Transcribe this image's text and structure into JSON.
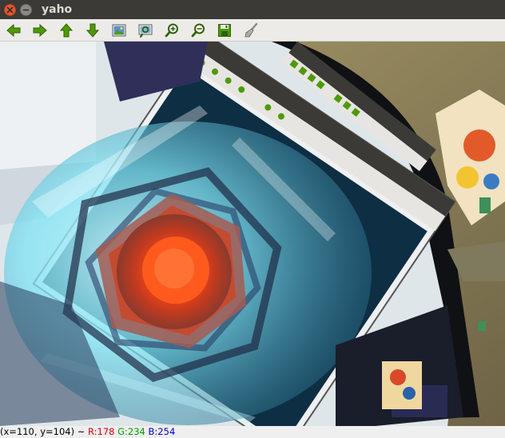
{
  "window": {
    "title": "yaho"
  },
  "toolbar": {
    "buttons": [
      {
        "name": "pan-left",
        "icon": "arrow-left-icon"
      },
      {
        "name": "pan-right",
        "icon": "arrow-right-icon"
      },
      {
        "name": "pan-up",
        "icon": "arrow-up-icon"
      },
      {
        "name": "pan-down",
        "icon": "arrow-down-icon"
      },
      {
        "name": "zoom-original",
        "icon": "image-icon"
      },
      {
        "name": "zoom-fit",
        "icon": "zoom-frame-icon"
      },
      {
        "name": "zoom-in",
        "icon": "zoom-in-icon"
      },
      {
        "name": "zoom-out",
        "icon": "zoom-out-icon"
      },
      {
        "name": "save",
        "icon": "floppy-disk-icon"
      },
      {
        "name": "properties",
        "icon": "brush-icon"
      }
    ]
  },
  "image": {
    "description_colors": {
      "core": "#ff5a1e",
      "glow": "#7fe3f5",
      "frame": "#1f2030"
    }
  },
  "status": {
    "coords": "(x=110, y=104) ~",
    "r": "R:178",
    "g": "G:234",
    "b": "B:254"
  },
  "colors": {
    "red": "#e00000",
    "green": "#00a000",
    "blue": "#0000e0"
  }
}
